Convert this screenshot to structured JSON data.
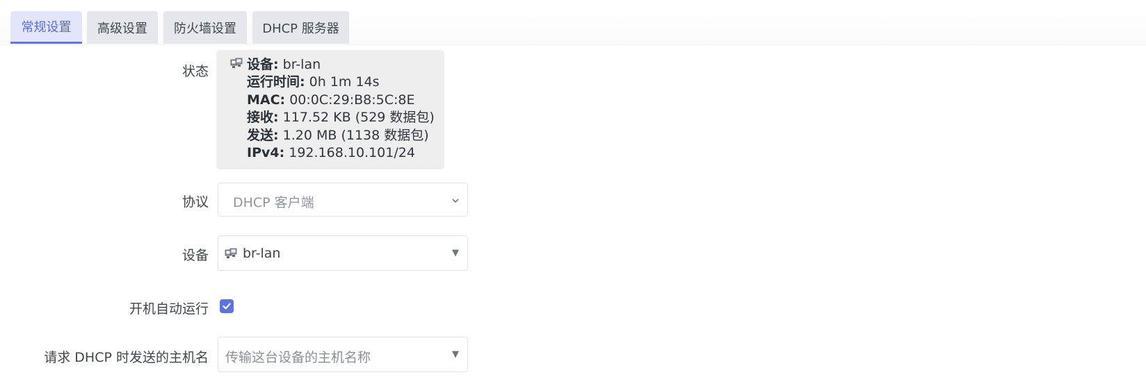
{
  "tabs": [
    {
      "label": "常规设置",
      "active": true
    },
    {
      "label": "高级设置",
      "active": false
    },
    {
      "label": "防火墙设置",
      "active": false
    },
    {
      "label": "DHCP 服务器",
      "active": false
    }
  ],
  "status": {
    "label": "状态",
    "icon": "ethernet-device-icon",
    "lines": [
      {
        "key": "设备:",
        "value": " br-lan"
      },
      {
        "key": "运行时间:",
        "value": " 0h 1m 14s"
      },
      {
        "key": "MAC:",
        "value": " 00:0C:29:B8:5C:8E"
      },
      {
        "key": "接收:",
        "value": " 117.52 KB (529 数据包)"
      },
      {
        "key": "发送:",
        "value": " 1.20 MB (1138 数据包)"
      },
      {
        "key": "IPv4:",
        "value": " 192.168.10.101/24"
      }
    ]
  },
  "protocol": {
    "label": "协议",
    "value": "DHCP 客户端"
  },
  "device": {
    "label": "设备",
    "value": "br-lan",
    "icon": "ethernet-device-icon"
  },
  "autostart": {
    "label": "开机自动运行",
    "checked": true
  },
  "hostname": {
    "label": "请求 DHCP 时发送的主机名",
    "placeholder": "传输这台设备的主机名称"
  },
  "colors": {
    "accent": "#5f72e3",
    "active_tab_bg": "#e3e6fb",
    "tab_bg": "#e4e7eb",
    "status_bg": "#eeeeee"
  }
}
